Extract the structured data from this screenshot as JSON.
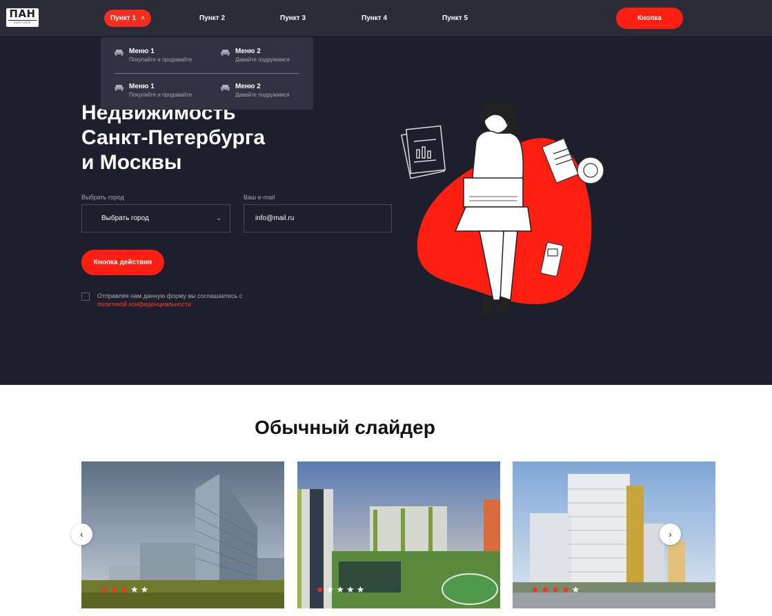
{
  "header": {
    "logo": {
      "main": "ПАН",
      "sub": "ПАРТНЁР"
    },
    "nav": [
      {
        "label": "Пункт 1",
        "active": true
      },
      {
        "label": "Пункт 2"
      },
      {
        "label": "Пункт 3"
      },
      {
        "label": "Пункт 4"
      },
      {
        "label": "Пункт 5"
      }
    ],
    "button_label": "Кнопка",
    "accent_color": "#ff1e12"
  },
  "dropdown": {
    "items": [
      {
        "title": "Меню 1",
        "subtitle": "Покупайте и продавайте",
        "icon": "sofa-icon"
      },
      {
        "title": "Меню 2",
        "subtitle": "Давайте подружимся",
        "icon": "sofa-icon"
      },
      {
        "title": "Меню 1",
        "subtitle": "Покупайте и продавайте",
        "icon": "sofa-icon"
      },
      {
        "title": "Меню 2",
        "subtitle": "Давайте подружимся",
        "icon": "sofa-icon"
      }
    ]
  },
  "hero": {
    "title_lines": [
      "Недвижимость",
      "Санкт-Петербурга",
      "и Москвы"
    ],
    "city_label": "Выбрать город",
    "city_value": "Выбрать город",
    "email_label": "Ваш e-mail",
    "email_value": "info@mail.ru",
    "action_button": "Кнопка действия",
    "consent_text": "Отправляя нам данную форму вы соглашаетесь с",
    "consent_link": "политикой конфиденциальности",
    "background_color": "#1e1f2c"
  },
  "slider": {
    "title": "Обычный слайдер",
    "prev_icon": "‹",
    "next_icon": "›",
    "cards": [
      {
        "rating": 3,
        "max_rating": 5
      },
      {
        "rating": 1,
        "max_rating": 5
      },
      {
        "rating": 4,
        "max_rating": 5
      }
    ]
  }
}
